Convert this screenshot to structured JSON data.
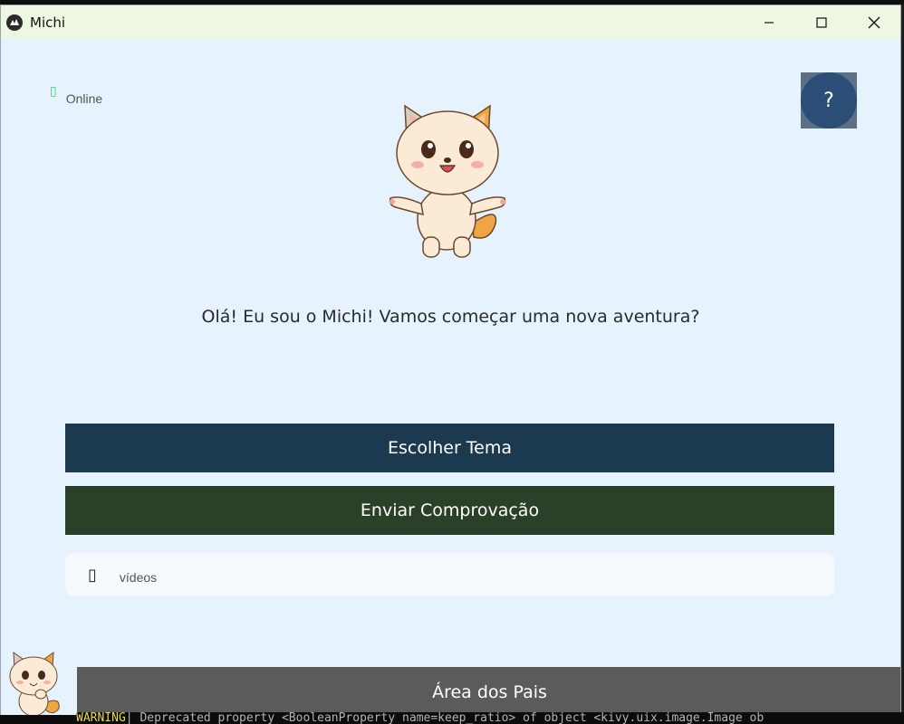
{
  "window": {
    "title": "Michi",
    "controls": [
      "minimize",
      "maximize",
      "close"
    ]
  },
  "status": {
    "icon": "wifi-icon",
    "text": "Online",
    "color": "#3ecb6b"
  },
  "help": {
    "label": "?"
  },
  "greeting": "Olá! Eu sou o Michi! Vamos começar uma nova aventura?",
  "buttons": {
    "choose_theme": "Escolher Tema ",
    "send_proof": "Enviar Comprovação ",
    "parents_area": "Área dos Pais "
  },
  "videos": {
    "icon": "video-icon",
    "label": "vídeos"
  },
  "terminal": {
    "level": "WARNING",
    "message": "| Deprecated property <BooleanProperty name=keep_ratio> of object <kivy.uix.image.Image ob"
  },
  "colors": {
    "background": "#e6f2fd",
    "titlebar": "#edf7e1",
    "choose_theme_button": "#1b3a4f",
    "send_proof_button": "#2b4029",
    "parents_button": "#5b5b5b",
    "help_button": "#2c4d76"
  }
}
